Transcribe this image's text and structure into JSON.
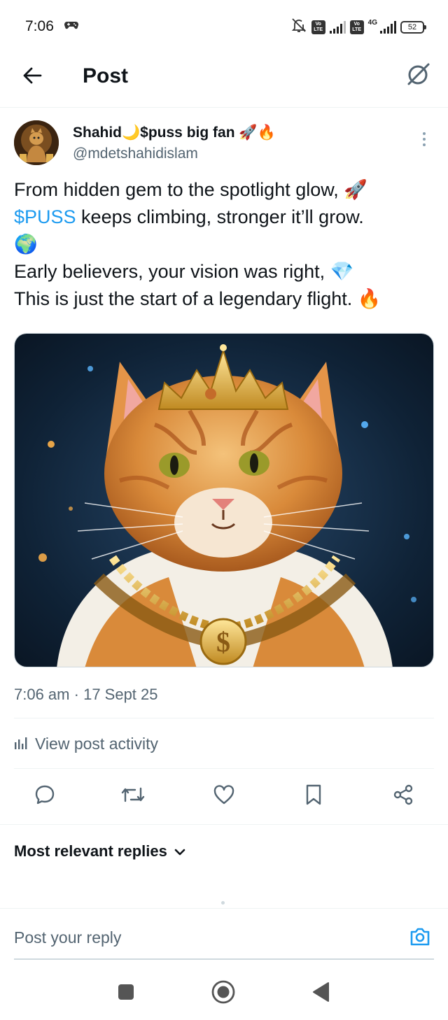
{
  "status_bar": {
    "time": "7:06",
    "network": "4G",
    "battery": "52",
    "volte": "Vo LTE"
  },
  "header": {
    "title": "Post",
    "back_icon": "arrow-left-icon",
    "grok_icon": "grok-icon"
  },
  "author": {
    "name": "Shahid",
    "name_moon": "🌙",
    "name_suffix": "$puss big fan",
    "name_emoji": "🚀🔥",
    "handle": "@mdetshahidislam"
  },
  "tweet": {
    "line1": "From hidden gem to the spotlight glow, 🚀",
    "cashtag": "$PUSS",
    "line2_rest": " keeps climbing, stronger it’ll grow.",
    "line3": "🌍",
    "line4": "Early believers, your vision was right, 💎",
    "line5": "This is just the start of a legendary flight. 🔥",
    "image_alt": "Orange cat wearing a golden crown and a gold chain with a dollar medallion"
  },
  "meta": {
    "time": "7:06 am",
    "separator": "·",
    "date": "17 Sept 25"
  },
  "activity": {
    "label": "View post activity",
    "icon": "bar-chart-icon"
  },
  "actions": [
    {
      "name": "reply",
      "icon": "comment-icon"
    },
    {
      "name": "repost",
      "icon": "repost-icon"
    },
    {
      "name": "like",
      "icon": "heart-icon"
    },
    {
      "name": "bookmark",
      "icon": "bookmark-icon"
    },
    {
      "name": "share",
      "icon": "share-icon"
    }
  ],
  "replies": {
    "sort_label": "Most relevant replies",
    "icon": "chevron-down-icon"
  },
  "composer": {
    "placeholder": "Post your reply",
    "icon": "camera-icon"
  },
  "colors": {
    "accent": "#1d9bf0",
    "text": "#0f1419",
    "secondary": "#536471",
    "divider": "#eff3f4"
  }
}
